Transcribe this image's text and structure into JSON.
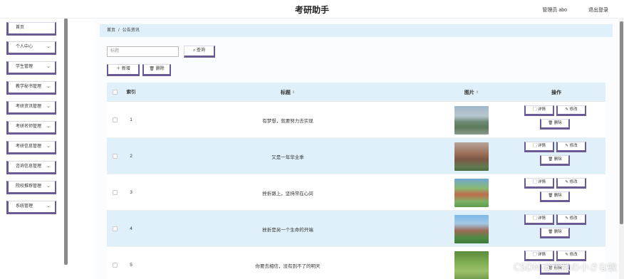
{
  "header": {
    "title": "考研助手",
    "user": "管理员 abo",
    "logout": "退出登录"
  },
  "sidebar": {
    "items": [
      {
        "label": "首页",
        "has_children": false
      },
      {
        "label": "个人中心",
        "has_children": true
      },
      {
        "label": "学生管理",
        "has_children": true
      },
      {
        "label": "教学秘书管理",
        "has_children": true
      },
      {
        "label": "考研资讯管理",
        "has_children": true
      },
      {
        "label": "考研名师管理",
        "has_children": true
      },
      {
        "label": "考研信息管理",
        "has_children": true
      },
      {
        "label": "咨询信息管理",
        "has_children": true
      },
      {
        "label": "院校推荐管理",
        "has_children": true
      },
      {
        "label": "系统管理",
        "has_children": true
      }
    ]
  },
  "breadcrumb": {
    "home": "首页",
    "separator": "/",
    "current": "公告资讯"
  },
  "search": {
    "placeholder": "标题",
    "button": "查询"
  },
  "toolbar": {
    "add": "新增",
    "delete": "删除"
  },
  "table": {
    "columns": {
      "index": "索引",
      "title": "标题",
      "image": "图片",
      "actions": "操作"
    },
    "actions": {
      "detail": "详情",
      "edit": "修改",
      "delete": "删除"
    },
    "rows": [
      {
        "index": "1",
        "title": "有梦想，就要努力去实现"
      },
      {
        "index": "2",
        "title": "又是一年毕业季"
      },
      {
        "index": "3",
        "title": "挫折路上，坚持常在心间"
      },
      {
        "index": "4",
        "title": "挫折是另一个生命的开端"
      },
      {
        "index": "5",
        "title": "你要去相信，没有到不了的明天"
      }
    ]
  },
  "watermark": "CSDN @无敌の小さな蚊"
}
